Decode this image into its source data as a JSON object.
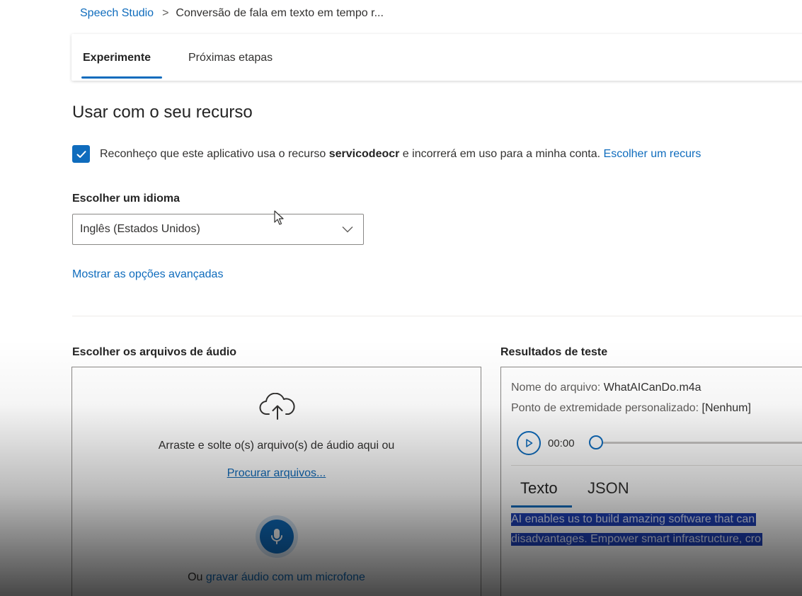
{
  "breadcrumb": {
    "root": "Speech Studio",
    "separator": ">",
    "current": "Conversão de fala em texto em tempo r..."
  },
  "tabs": {
    "active": "Experimente",
    "inactive": "Próximas etapas"
  },
  "section": {
    "title": "Usar com o seu recurso"
  },
  "acknowledgement": {
    "checked": true,
    "prefix": "Reconheço que este aplicativo usa o recurso ",
    "resource": "servicodeocr",
    "suffix": " e incorrerá em uso para a minha conta. ",
    "link": "Escolher um recurs"
  },
  "language": {
    "label": "Escolher um idioma",
    "selected": "Inglês (Estados Unidos)"
  },
  "advanced_link": "Mostrar as opções avançadas",
  "upload": {
    "label": "Escolher os arquivos de áudio",
    "drag_text": "Arraste e solte o(s) arquivo(s) de áudio aqui ou",
    "browse_link": "Procurar arquivos...",
    "record_prefix": "Ou ",
    "record_link": "gravar áudio com um microfone"
  },
  "results": {
    "label": "Resultados de teste",
    "file_name_label": "Nome do arquivo: ",
    "file_name_value": "WhatAICanDo.m4a",
    "endpoint_label": "Ponto de extremidade personalizado: ",
    "endpoint_value": "[Nenhum]",
    "time": "00:00",
    "tab_text": "Texto",
    "tab_json": "JSON",
    "transcript_line1": "AI enables us to build amazing software that can",
    "transcript_line2": "disadvantages. Empower smart infrastructure, cro"
  },
  "colors": {
    "accent": "#0f6cbd",
    "selection": "#1e40b8"
  }
}
